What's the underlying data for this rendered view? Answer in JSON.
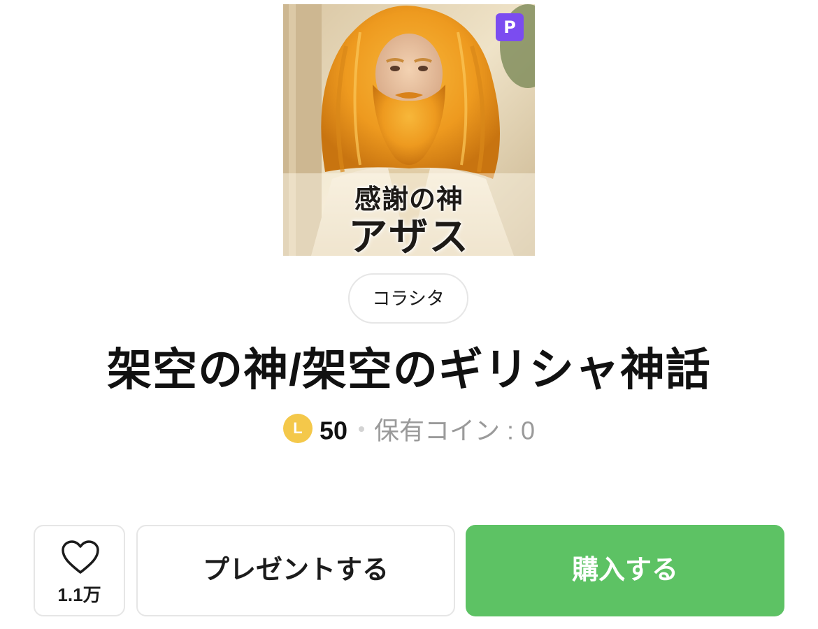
{
  "product": {
    "image_text_line1": "感謝の神",
    "image_text_line2": "アザス",
    "premium_badge": "P",
    "creator": "コラシタ",
    "title": "架空の神/架空のギリシャ神話"
  },
  "price": {
    "coin_symbol": "L",
    "value": "50",
    "owned_coins": "保有コイン : 0"
  },
  "actions": {
    "like_count": "1.1万",
    "gift_label": "プレゼントする",
    "buy_label": "購入する"
  },
  "colors": {
    "buy_button": "#5dc264",
    "coin": "#f4c84a",
    "premium_badge": "#7b4cf0",
    "border": "#e6e6e6",
    "muted_text": "#9a9a9a"
  },
  "icons": {
    "like": "heart-outline-icon",
    "coin": "line-coin-icon",
    "premium": "premium-p-badge-icon"
  }
}
